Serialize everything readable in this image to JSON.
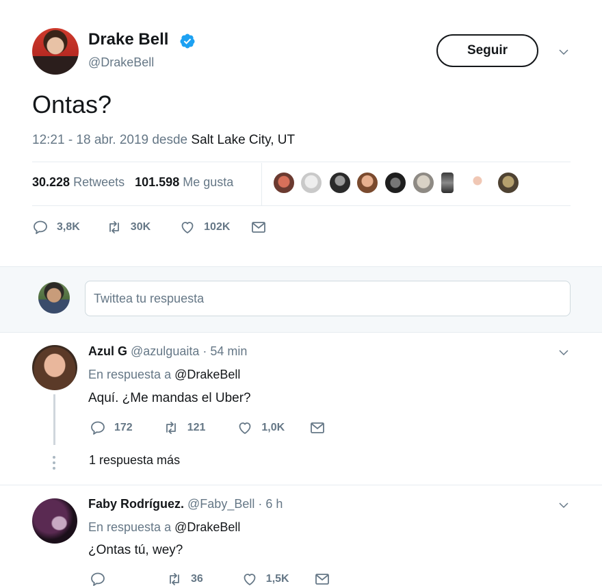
{
  "tweet": {
    "author_name": "Drake Bell",
    "author_handle": "@DrakeBell",
    "follow_label": "Seguir",
    "text": "Ontas?",
    "time_date": "12:21 - 18 abr. 2019 desde ",
    "location": "Salt Lake City, UT",
    "retweets_count": "30.228",
    "retweets_label": "Retweets",
    "likes_count": "101.598",
    "likes_label": "Me gusta",
    "actions": {
      "replies": "3,8K",
      "retweets": "30K",
      "likes": "102K"
    }
  },
  "compose": {
    "placeholder": "Twittea tu respuesta"
  },
  "replies": [
    {
      "name": "Azul G",
      "handle": "@azulguaita",
      "time": "· 54 min",
      "in_reply_prefix": "En respuesta a ",
      "in_reply_to": "@DrakeBell",
      "text": "Aquí. ¿Me mandas el Uber?",
      "actions": {
        "replies": "172",
        "retweets": "121",
        "likes": "1,0K"
      },
      "more_label": "1 respuesta más"
    },
    {
      "name": "Faby Rodríguez.",
      "handle": "@Faby_Bell",
      "time": "· 6 h",
      "in_reply_prefix": "En respuesta a ",
      "in_reply_to": "@DrakeBell",
      "text": "¿Ontas tú, wey?",
      "actions": {
        "replies": "",
        "retweets": "36",
        "likes": "1,5K"
      }
    }
  ],
  "icons": {
    "verified": "verified-badge-icon",
    "chevron": "chevron-down-icon",
    "reply": "reply-icon",
    "retweet": "retweet-icon",
    "like": "heart-icon",
    "dm": "envelope-icon"
  },
  "colors": {
    "text": "#14171a",
    "muted": "#657786",
    "verified": "#1da1f2",
    "divider": "#e6ecf0",
    "compose_bg": "#f5f8fa"
  }
}
